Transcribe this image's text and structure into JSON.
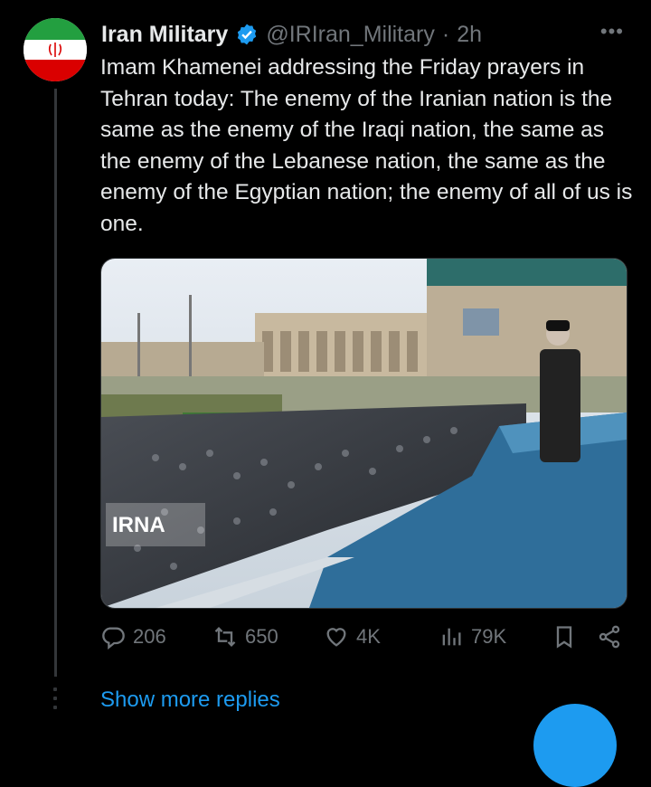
{
  "author": {
    "name": "Iran Military",
    "handle": "@IRIran_Military",
    "separator": "·",
    "time": "2h",
    "avatar_icon": "iran-flag-avatar",
    "verified_icon": "verified-badge-icon"
  },
  "tweet": {
    "text": "Imam Khamenei addressing the Friday prayers in Tehran today: The enemy of the Iranian nation is the same as the enemy of the Iraqi nation, the same as the enemy of the Lebanese nation, the same as the enemy of the Egyptian nation; the enemy of all of us is one.",
    "more_icon": "more-options-icon",
    "media_watermark": "IRNA"
  },
  "actions": {
    "replies": "206",
    "retweets": "650",
    "likes": "4K",
    "views": "79K"
  },
  "show_more_replies": "Show more replies",
  "colors": {
    "background": "#000000",
    "text": "#e7e9ea",
    "muted": "#71767b",
    "accent": "#1d9bf0"
  }
}
